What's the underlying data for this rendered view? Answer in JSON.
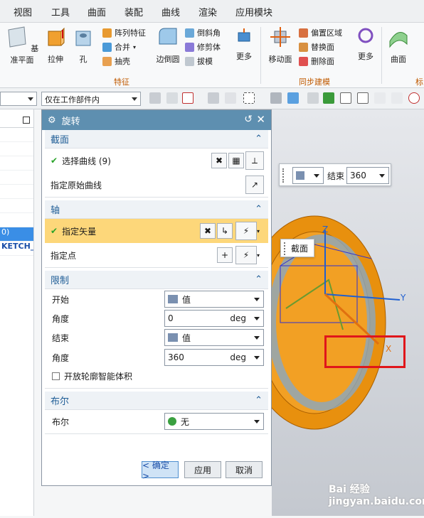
{
  "menu": [
    "视图",
    "工具",
    "曲面",
    "装配",
    "曲线",
    "渲染",
    "应用模块"
  ],
  "ribbon": {
    "big_buttons": [
      {
        "label": "基准平面",
        "icon": "datum-plane-icon"
      },
      {
        "label": "拉伸",
        "icon": "extrude-icon"
      },
      {
        "label": "孔",
        "icon": "hole-icon"
      },
      {
        "label": "边倒圆",
        "icon": "edge-blend-icon"
      },
      {
        "label": "更多",
        "icon": "more-icon"
      },
      {
        "label": "移动面",
        "icon": "move-face-icon"
      },
      {
        "label": "更多",
        "icon": "more-icon"
      },
      {
        "label": "曲面",
        "icon": "surface-icon"
      }
    ],
    "small_buttons": [
      {
        "label": "阵列特征",
        "icon": "pattern-icon"
      },
      {
        "label": "合并",
        "icon": "unite-icon"
      },
      {
        "label": "抽壳",
        "icon": "shell-icon"
      },
      {
        "label": "倒斜角",
        "icon": "chamfer-icon"
      },
      {
        "label": "修剪体",
        "icon": "trim-body-icon"
      },
      {
        "label": "拔模",
        "icon": "draft-icon"
      },
      {
        "label": "偏置区域",
        "icon": "offset-region-icon"
      },
      {
        "label": "替换面",
        "icon": "replace-face-icon"
      },
      {
        "label": "删除面",
        "icon": "delete-face-icon"
      }
    ],
    "groups": [
      "特征",
      "同步建模",
      "标"
    ]
  },
  "toolbar2": {
    "filter_value": "",
    "scope_value": "仅在工作部件内"
  },
  "navigator": {
    "rows": [
      "",
      "",
      "",
      "",
      "",
      "",
      "",
      "0)",
      "KETCH_..."
    ]
  },
  "dialog": {
    "title": "旋转",
    "section_section": {
      "title": "截面",
      "select_curve": "选择曲线 (9)",
      "specify_origin_curve": "指定原始曲线"
    },
    "section_axis": {
      "title": "轴",
      "specify_vector": "指定矢量",
      "specify_point": "指定点"
    },
    "section_limits": {
      "title": "限制",
      "start_label": "开始",
      "start_option": "值",
      "start_angle_label": "角度",
      "start_angle_value": "0",
      "end_label": "结束",
      "end_option": "值",
      "end_angle_label": "角度",
      "end_angle_value": "360",
      "unit": "deg",
      "open_profile_label": "开放轮廓智能体积"
    },
    "section_boolean": {
      "title": "布尔",
      "boolean_label": "布尔",
      "boolean_value": "无"
    },
    "buttons": {
      "ok": "< 确定 >",
      "apply": "应用",
      "cancel": "取消"
    }
  },
  "viewport": {
    "end_label": "结束",
    "end_value": "360",
    "section_label": "截面",
    "axis_x": "X",
    "axis_y": "Y",
    "axis_z": "Z",
    "part_color": "#e8900e",
    "highlight_box_color": "#e0161b"
  },
  "watermark": "Bai 经验 jingyan.baidu.com"
}
